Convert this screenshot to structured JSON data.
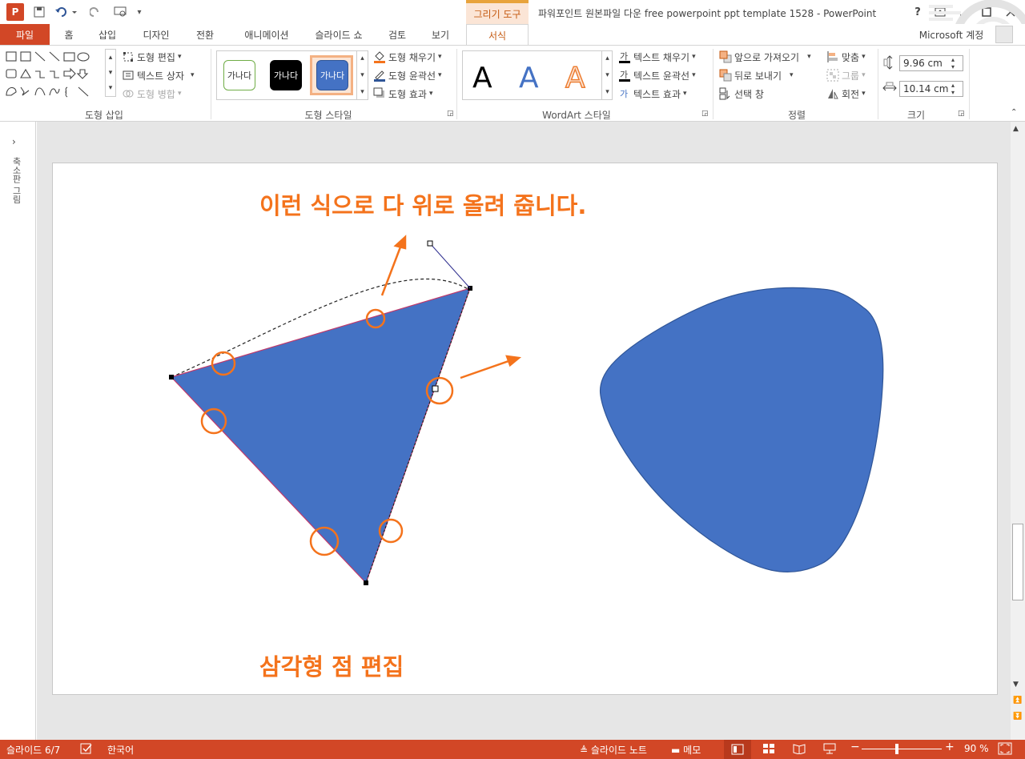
{
  "app": {
    "logo": "P",
    "title": "파워포인트 원본파일 다운 free powerpoint ppt template 1528 - PowerPoint",
    "contextual_group": "그리기 도구",
    "help": "?",
    "account": "Microsoft 계정"
  },
  "tabs": [
    "파일",
    "홈",
    "삽입",
    "디자인",
    "전환",
    "애니메이션",
    "슬라이드 쇼",
    "검토",
    "보기",
    "서식"
  ],
  "ribbon": {
    "insert_shapes": {
      "label": "도형 삽입",
      "edit_shape": "도형 편집",
      "text_box": "텍스트 상자",
      "merge_shapes": "도형 병합"
    },
    "shape_styles": {
      "label": "도형 스타일",
      "swatch_text": "가나다",
      "fill": "도형 채우기",
      "outline": "도형 윤곽선",
      "effects": "도형 효과"
    },
    "wordart": {
      "label": "WordArt 스타일",
      "letter": "A",
      "text_fill": "텍스트 채우기",
      "text_outline": "텍스트 윤곽선",
      "text_effects": "텍스트 효과"
    },
    "arrange": {
      "label": "정렬",
      "bring_forward": "앞으로 가져오기",
      "send_backward": "뒤로 보내기",
      "selection_pane": "선택 창",
      "align": "맞춤",
      "group": "그룹",
      "rotate": "회전"
    },
    "size": {
      "label": "크기",
      "height": "9.96 cm",
      "width": "10.14 cm"
    }
  },
  "left_pane": {
    "label": "축소판 그림"
  },
  "slide": {
    "headline": "이런 식으로 다 위로 올려 줍니다.",
    "caption": "삼각형 점 편집"
  },
  "status": {
    "slide": "슬라이드 6/7",
    "language": "한국어",
    "notes": "슬라이드 노트",
    "comments": "메모",
    "zoom": "90 %"
  },
  "colors": {
    "accent": "#d24726",
    "shape": "#4472c4",
    "annotation": "#f4731c"
  }
}
